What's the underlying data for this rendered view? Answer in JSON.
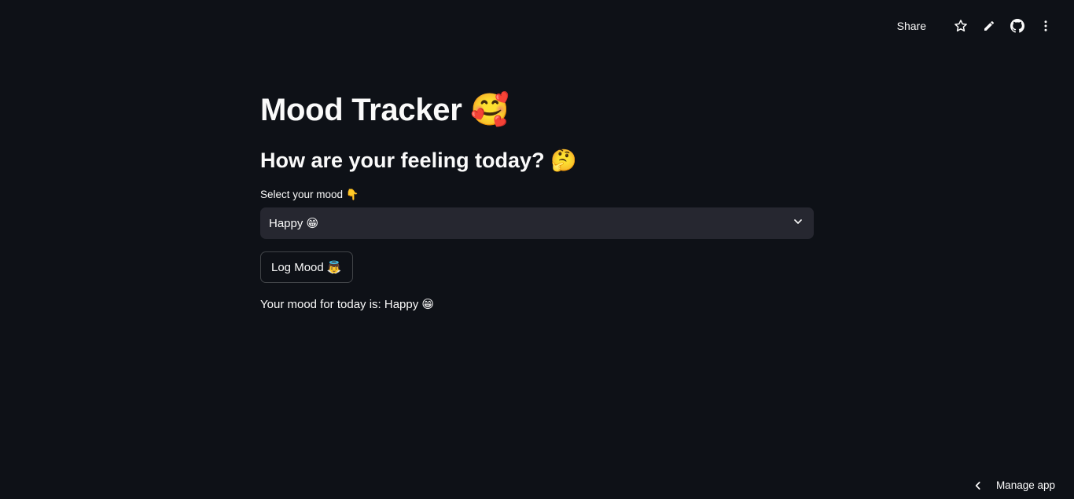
{
  "toolbar": {
    "share_label": "Share",
    "icons": [
      "star-icon",
      "pencil-icon",
      "github-icon",
      "more-vertical-icon"
    ]
  },
  "main": {
    "title": "Mood Tracker 🥰",
    "subtitle": "How are your feeling today? 🤔",
    "select_label": "Select your mood 👇",
    "select_value": "Happy 😁",
    "button_label": "Log Mood 👼",
    "result_text": "Your mood for today is: Happy 😁"
  },
  "footer": {
    "manage_label": "Manage app"
  },
  "colors": {
    "background": "#0e1117",
    "text": "#fafafa",
    "select_bg": "#262730"
  }
}
